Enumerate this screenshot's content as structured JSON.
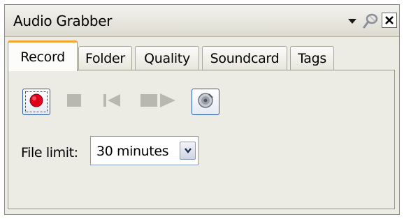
{
  "window": {
    "title": "Audio Grabber"
  },
  "titlebar": {
    "icons": [
      "chevron-down-icon",
      "pin-icon",
      "close-icon"
    ]
  },
  "tabs": [
    {
      "label": "Record",
      "active": true
    },
    {
      "label": "Folder",
      "active": false
    },
    {
      "label": "Quality",
      "active": false
    },
    {
      "label": "Soundcard",
      "active": false
    },
    {
      "label": "Tags",
      "active": false
    }
  ],
  "toolbar": {
    "buttons": [
      {
        "icon": "record-icon",
        "enabled": true
      },
      {
        "icon": "stop-icon",
        "enabled": false
      },
      {
        "icon": "skip-back-icon",
        "enabled": false
      },
      {
        "icon": "play-icon",
        "enabled": false
      },
      {
        "icon": "speaker-icon",
        "enabled": true
      }
    ]
  },
  "file_limit": {
    "label": "File limit:",
    "value": "30 minutes"
  },
  "colors": {
    "accent_tab": "#f1a533",
    "record_red": "#e0001c",
    "button_border": "#2d5fa8"
  }
}
